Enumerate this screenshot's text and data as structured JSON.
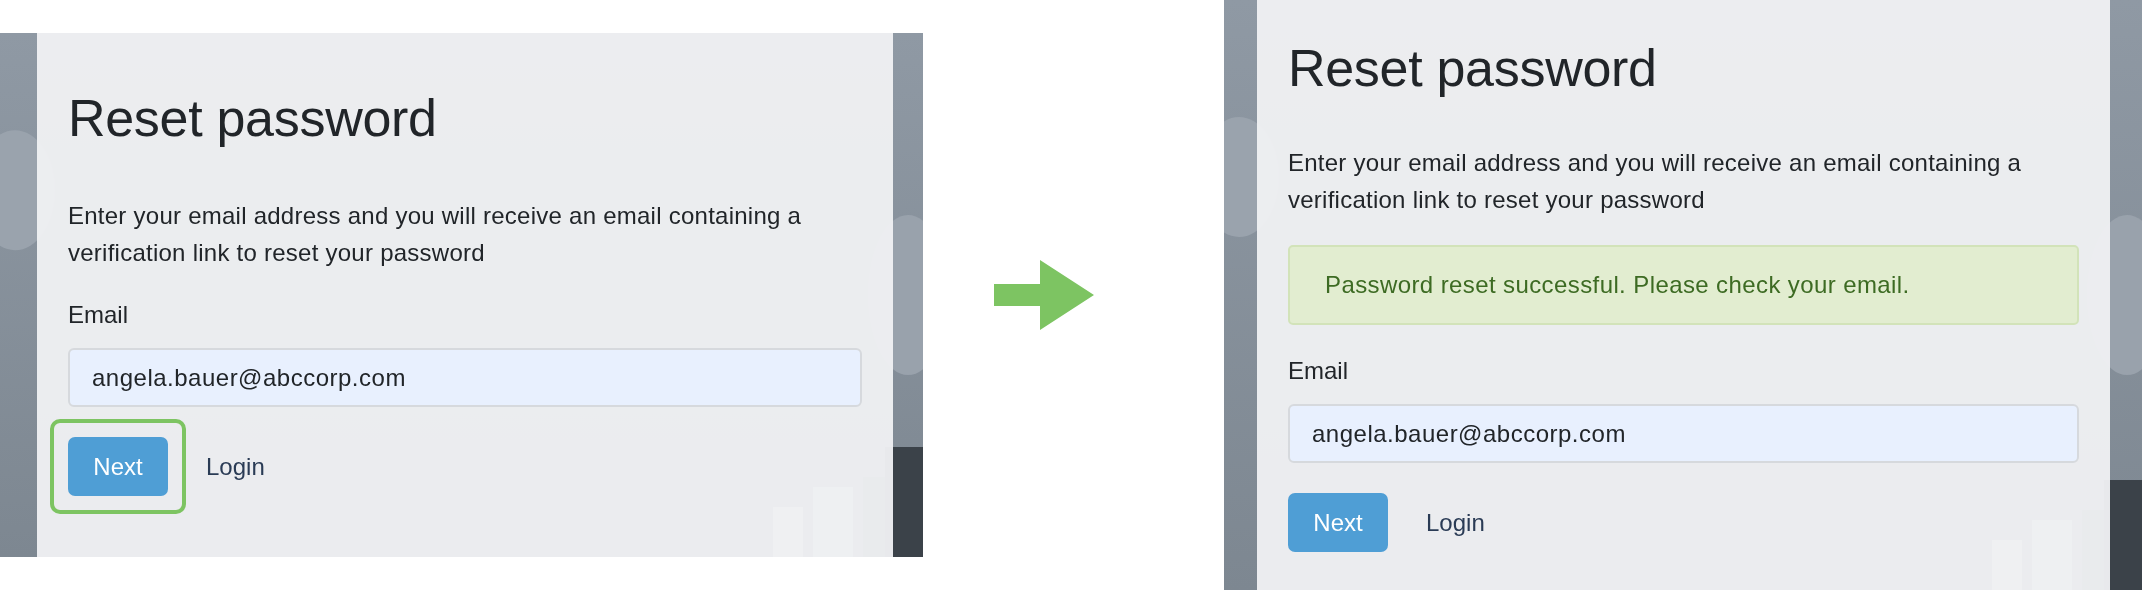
{
  "screens": [
    {
      "title": "Reset password",
      "description": "Enter your email address and you will receive an email containing a verification link to reset your password",
      "email_label": "Email",
      "email_value": "angela.bauer@abccorp.com",
      "next_button": {
        "label": "Next",
        "highlighted": true
      },
      "login_link": "Login"
    },
    {
      "title": "Reset password",
      "description": "Enter your email address and you will receive an email containing a verification link to reset your password",
      "alert": {
        "kind": "success",
        "text": "Password reset successful. Please check your email."
      },
      "email_label": "Email",
      "email_value": "angela.bauer@abccorp.com",
      "next_button": {
        "label": "Next",
        "highlighted": false
      },
      "login_link": "Login"
    }
  ]
}
